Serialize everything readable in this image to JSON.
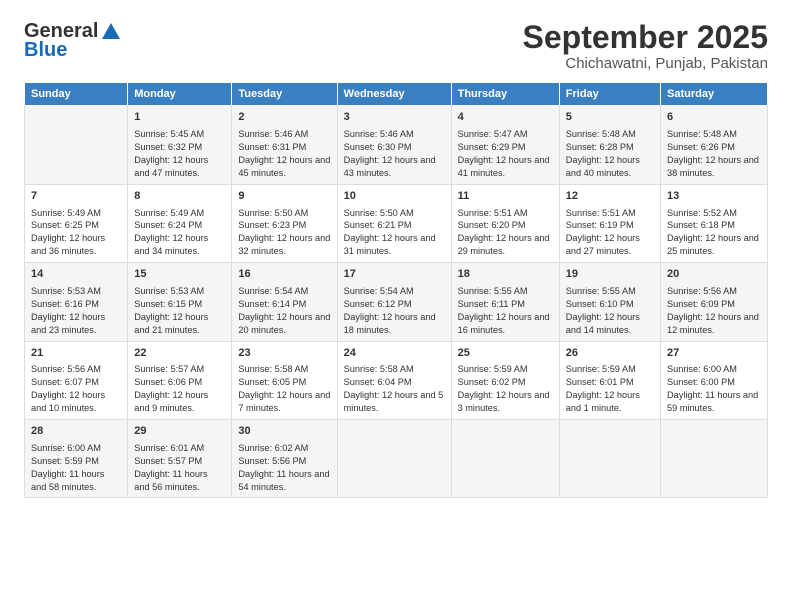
{
  "header": {
    "logo_line1": "General",
    "logo_line2": "Blue",
    "title": "September 2025",
    "subtitle": "Chichawatni, Punjab, Pakistan"
  },
  "days_of_week": [
    "Sunday",
    "Monday",
    "Tuesday",
    "Wednesday",
    "Thursday",
    "Friday",
    "Saturday"
  ],
  "weeks": [
    [
      {
        "day": "",
        "sunrise": "",
        "sunset": "",
        "daylight": ""
      },
      {
        "day": "1",
        "sunrise": "Sunrise: 5:45 AM",
        "sunset": "Sunset: 6:32 PM",
        "daylight": "Daylight: 12 hours and 47 minutes."
      },
      {
        "day": "2",
        "sunrise": "Sunrise: 5:46 AM",
        "sunset": "Sunset: 6:31 PM",
        "daylight": "Daylight: 12 hours and 45 minutes."
      },
      {
        "day": "3",
        "sunrise": "Sunrise: 5:46 AM",
        "sunset": "Sunset: 6:30 PM",
        "daylight": "Daylight: 12 hours and 43 minutes."
      },
      {
        "day": "4",
        "sunrise": "Sunrise: 5:47 AM",
        "sunset": "Sunset: 6:29 PM",
        "daylight": "Daylight: 12 hours and 41 minutes."
      },
      {
        "day": "5",
        "sunrise": "Sunrise: 5:48 AM",
        "sunset": "Sunset: 6:28 PM",
        "daylight": "Daylight: 12 hours and 40 minutes."
      },
      {
        "day": "6",
        "sunrise": "Sunrise: 5:48 AM",
        "sunset": "Sunset: 6:26 PM",
        "daylight": "Daylight: 12 hours and 38 minutes."
      }
    ],
    [
      {
        "day": "7",
        "sunrise": "Sunrise: 5:49 AM",
        "sunset": "Sunset: 6:25 PM",
        "daylight": "Daylight: 12 hours and 36 minutes."
      },
      {
        "day": "8",
        "sunrise": "Sunrise: 5:49 AM",
        "sunset": "Sunset: 6:24 PM",
        "daylight": "Daylight: 12 hours and 34 minutes."
      },
      {
        "day": "9",
        "sunrise": "Sunrise: 5:50 AM",
        "sunset": "Sunset: 6:23 PM",
        "daylight": "Daylight: 12 hours and 32 minutes."
      },
      {
        "day": "10",
        "sunrise": "Sunrise: 5:50 AM",
        "sunset": "Sunset: 6:21 PM",
        "daylight": "Daylight: 12 hours and 31 minutes."
      },
      {
        "day": "11",
        "sunrise": "Sunrise: 5:51 AM",
        "sunset": "Sunset: 6:20 PM",
        "daylight": "Daylight: 12 hours and 29 minutes."
      },
      {
        "day": "12",
        "sunrise": "Sunrise: 5:51 AM",
        "sunset": "Sunset: 6:19 PM",
        "daylight": "Daylight: 12 hours and 27 minutes."
      },
      {
        "day": "13",
        "sunrise": "Sunrise: 5:52 AM",
        "sunset": "Sunset: 6:18 PM",
        "daylight": "Daylight: 12 hours and 25 minutes."
      }
    ],
    [
      {
        "day": "14",
        "sunrise": "Sunrise: 5:53 AM",
        "sunset": "Sunset: 6:16 PM",
        "daylight": "Daylight: 12 hours and 23 minutes."
      },
      {
        "day": "15",
        "sunrise": "Sunrise: 5:53 AM",
        "sunset": "Sunset: 6:15 PM",
        "daylight": "Daylight: 12 hours and 21 minutes."
      },
      {
        "day": "16",
        "sunrise": "Sunrise: 5:54 AM",
        "sunset": "Sunset: 6:14 PM",
        "daylight": "Daylight: 12 hours and 20 minutes."
      },
      {
        "day": "17",
        "sunrise": "Sunrise: 5:54 AM",
        "sunset": "Sunset: 6:12 PM",
        "daylight": "Daylight: 12 hours and 18 minutes."
      },
      {
        "day": "18",
        "sunrise": "Sunrise: 5:55 AM",
        "sunset": "Sunset: 6:11 PM",
        "daylight": "Daylight: 12 hours and 16 minutes."
      },
      {
        "day": "19",
        "sunrise": "Sunrise: 5:55 AM",
        "sunset": "Sunset: 6:10 PM",
        "daylight": "Daylight: 12 hours and 14 minutes."
      },
      {
        "day": "20",
        "sunrise": "Sunrise: 5:56 AM",
        "sunset": "Sunset: 6:09 PM",
        "daylight": "Daylight: 12 hours and 12 minutes."
      }
    ],
    [
      {
        "day": "21",
        "sunrise": "Sunrise: 5:56 AM",
        "sunset": "Sunset: 6:07 PM",
        "daylight": "Daylight: 12 hours and 10 minutes."
      },
      {
        "day": "22",
        "sunrise": "Sunrise: 5:57 AM",
        "sunset": "Sunset: 6:06 PM",
        "daylight": "Daylight: 12 hours and 9 minutes."
      },
      {
        "day": "23",
        "sunrise": "Sunrise: 5:58 AM",
        "sunset": "Sunset: 6:05 PM",
        "daylight": "Daylight: 12 hours and 7 minutes."
      },
      {
        "day": "24",
        "sunrise": "Sunrise: 5:58 AM",
        "sunset": "Sunset: 6:04 PM",
        "daylight": "Daylight: 12 hours and 5 minutes."
      },
      {
        "day": "25",
        "sunrise": "Sunrise: 5:59 AM",
        "sunset": "Sunset: 6:02 PM",
        "daylight": "Daylight: 12 hours and 3 minutes."
      },
      {
        "day": "26",
        "sunrise": "Sunrise: 5:59 AM",
        "sunset": "Sunset: 6:01 PM",
        "daylight": "Daylight: 12 hours and 1 minute."
      },
      {
        "day": "27",
        "sunrise": "Sunrise: 6:00 AM",
        "sunset": "Sunset: 6:00 PM",
        "daylight": "Daylight: 11 hours and 59 minutes."
      }
    ],
    [
      {
        "day": "28",
        "sunrise": "Sunrise: 6:00 AM",
        "sunset": "Sunset: 5:59 PM",
        "daylight": "Daylight: 11 hours and 58 minutes."
      },
      {
        "day": "29",
        "sunrise": "Sunrise: 6:01 AM",
        "sunset": "Sunset: 5:57 PM",
        "daylight": "Daylight: 11 hours and 56 minutes."
      },
      {
        "day": "30",
        "sunrise": "Sunrise: 6:02 AM",
        "sunset": "Sunset: 5:56 PM",
        "daylight": "Daylight: 11 hours and 54 minutes."
      },
      {
        "day": "",
        "sunrise": "",
        "sunset": "",
        "daylight": ""
      },
      {
        "day": "",
        "sunrise": "",
        "sunset": "",
        "daylight": ""
      },
      {
        "day": "",
        "sunrise": "",
        "sunset": "",
        "daylight": ""
      },
      {
        "day": "",
        "sunrise": "",
        "sunset": "",
        "daylight": ""
      }
    ]
  ]
}
